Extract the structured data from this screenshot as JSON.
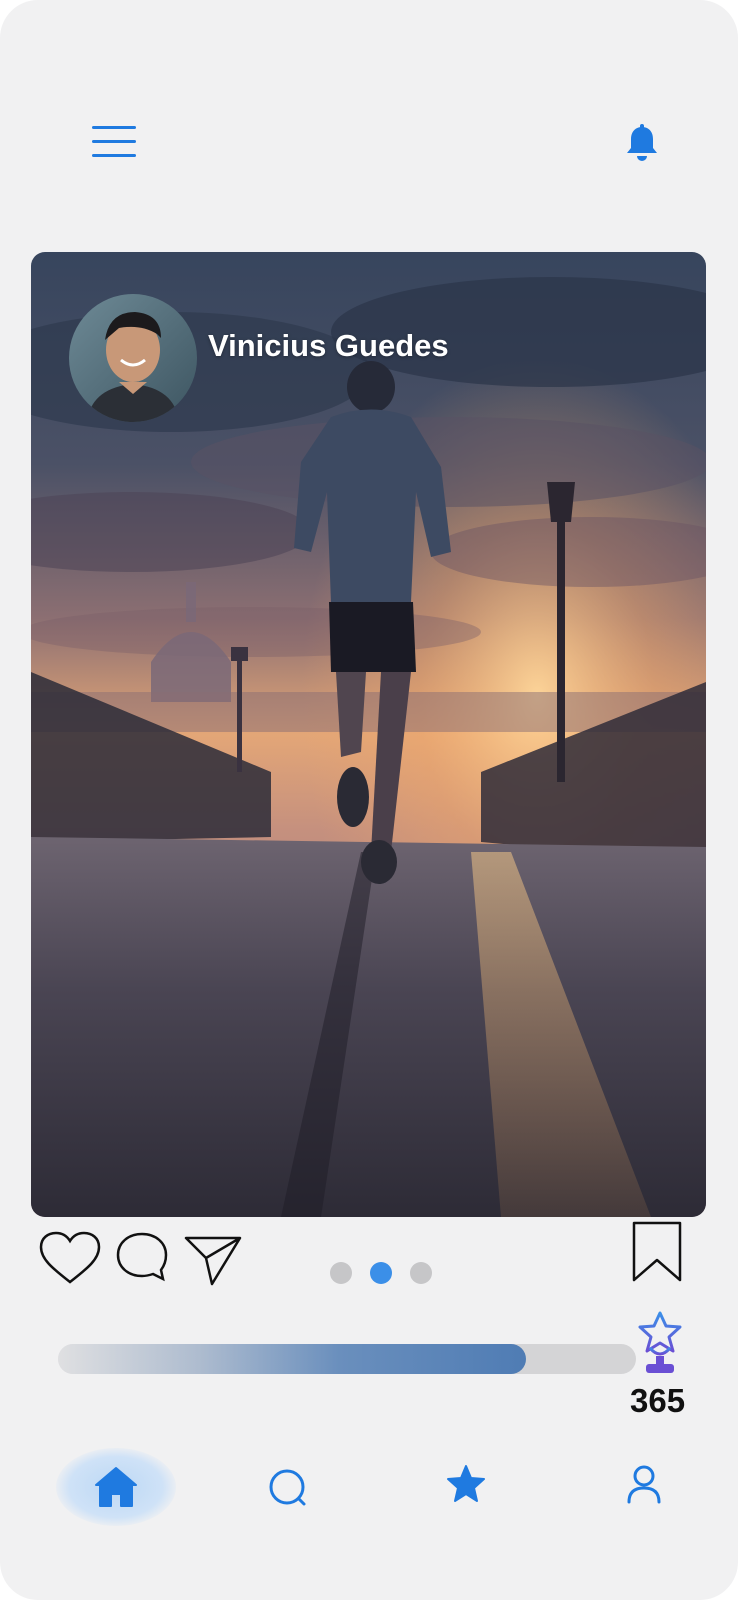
{
  "header": {
    "menu_icon": "hamburger-menu-icon",
    "notification_icon": "bell-icon"
  },
  "post": {
    "author": "Vinicius Guedes",
    "carousel": {
      "count": 3,
      "active_index": 1
    }
  },
  "actions": {
    "like_icon": "heart-icon",
    "comment_icon": "comment-bubble-icon",
    "share_icon": "paper-plane-icon",
    "save_icon": "bookmark-icon"
  },
  "progress": {
    "fraction": 0.81,
    "trophy_icon": "trophy-star-icon",
    "count": "365"
  },
  "bottom_nav": {
    "items": [
      {
        "icon": "home-icon",
        "active": true
      },
      {
        "icon": "search-icon",
        "active": false
      },
      {
        "icon": "star-icon",
        "active": false
      },
      {
        "icon": "user-icon",
        "active": false
      }
    ]
  },
  "colors": {
    "accent": "#1f7ae0",
    "background": "#f1f1f2",
    "progress_fill": "#4f7cb4",
    "trophy": "#6a4fd4"
  }
}
